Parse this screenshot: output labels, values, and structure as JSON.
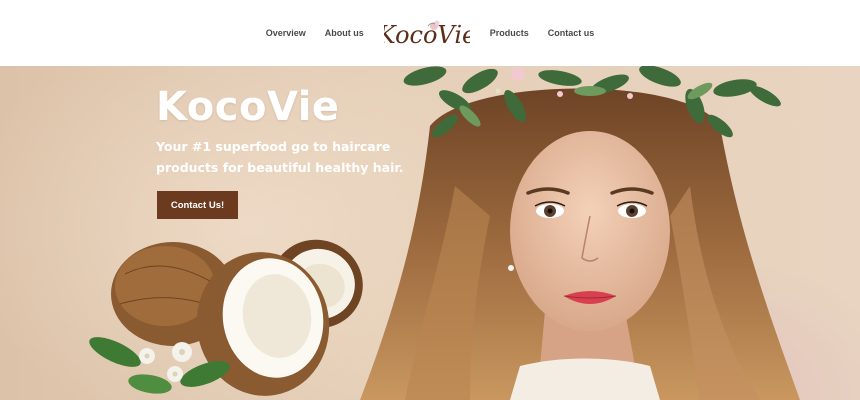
{
  "nav": {
    "left_links": [
      "Overview",
      "About us"
    ],
    "right_links": [
      "Products",
      "Contact us"
    ],
    "logo_text": "KocoVie"
  },
  "hero": {
    "title": "KocoVie",
    "tagline": "Your #1 superfood go to haircare products for beautiful healthy hair.",
    "cta_label": "Contact Us!"
  },
  "colors": {
    "button": "#6b3a1f",
    "nav_text": "#4a4a4a",
    "logo_text": "#5a2e1a",
    "hero_bg": "#e2cbb3"
  },
  "icons": {
    "logo": "kocovie-logo",
    "hero_image": "woman-with-flower-crown",
    "product_image": "coconut-halves-with-flowers"
  }
}
